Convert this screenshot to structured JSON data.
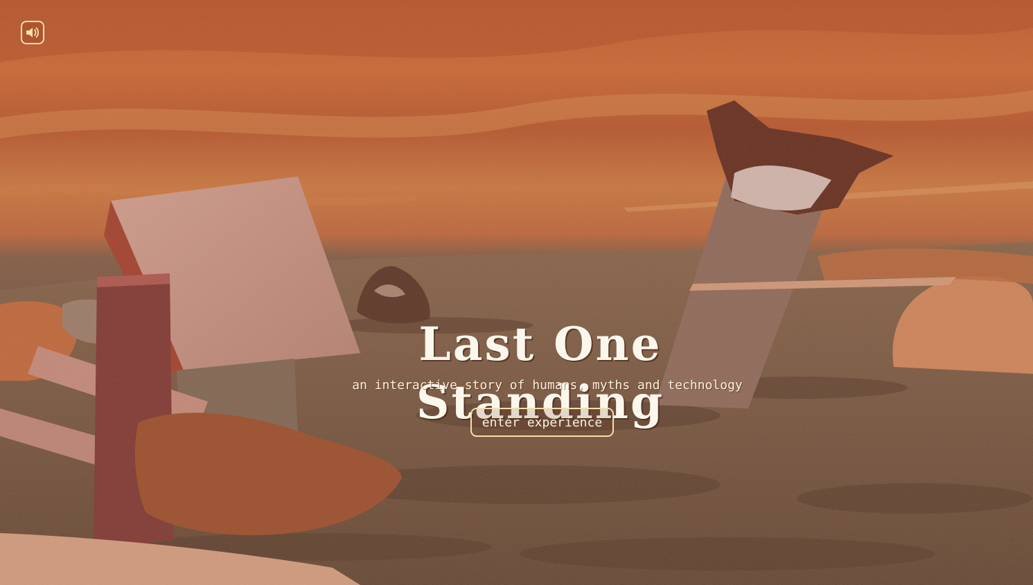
{
  "sound_toggle": {
    "icon": "speaker-icon",
    "state": "on"
  },
  "hero": {
    "title": "Last One Standing",
    "subtitle": "an interactive story of humans, myths and technology",
    "enter_label": "enter experience"
  },
  "colors": {
    "accent": "#f6dfae",
    "text": "#fbf7ec",
    "sky": "#c35a2c",
    "ground": "#6f5444"
  }
}
